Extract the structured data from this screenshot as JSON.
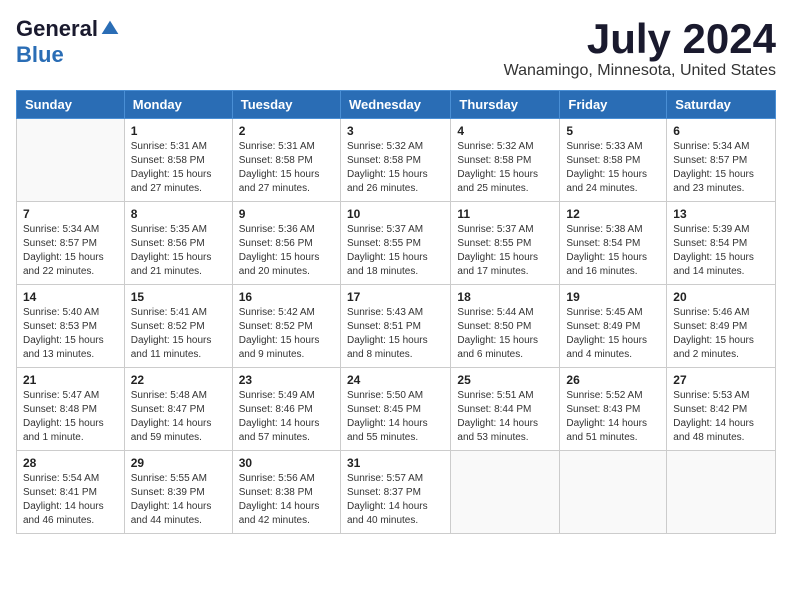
{
  "logo": {
    "general": "General",
    "blue": "Blue"
  },
  "title": "July 2024",
  "location": "Wanamingo, Minnesota, United States",
  "days_of_week": [
    "Sunday",
    "Monday",
    "Tuesday",
    "Wednesday",
    "Thursday",
    "Friday",
    "Saturday"
  ],
  "weeks": [
    [
      {
        "day": "",
        "sunrise": "",
        "sunset": "",
        "daylight": ""
      },
      {
        "day": "1",
        "sunrise": "Sunrise: 5:31 AM",
        "sunset": "Sunset: 8:58 PM",
        "daylight": "Daylight: 15 hours and 27 minutes."
      },
      {
        "day": "2",
        "sunrise": "Sunrise: 5:31 AM",
        "sunset": "Sunset: 8:58 PM",
        "daylight": "Daylight: 15 hours and 27 minutes."
      },
      {
        "day": "3",
        "sunrise": "Sunrise: 5:32 AM",
        "sunset": "Sunset: 8:58 PM",
        "daylight": "Daylight: 15 hours and 26 minutes."
      },
      {
        "day": "4",
        "sunrise": "Sunrise: 5:32 AM",
        "sunset": "Sunset: 8:58 PM",
        "daylight": "Daylight: 15 hours and 25 minutes."
      },
      {
        "day": "5",
        "sunrise": "Sunrise: 5:33 AM",
        "sunset": "Sunset: 8:58 PM",
        "daylight": "Daylight: 15 hours and 24 minutes."
      },
      {
        "day": "6",
        "sunrise": "Sunrise: 5:34 AM",
        "sunset": "Sunset: 8:57 PM",
        "daylight": "Daylight: 15 hours and 23 minutes."
      }
    ],
    [
      {
        "day": "7",
        "sunrise": "Sunrise: 5:34 AM",
        "sunset": "Sunset: 8:57 PM",
        "daylight": "Daylight: 15 hours and 22 minutes."
      },
      {
        "day": "8",
        "sunrise": "Sunrise: 5:35 AM",
        "sunset": "Sunset: 8:56 PM",
        "daylight": "Daylight: 15 hours and 21 minutes."
      },
      {
        "day": "9",
        "sunrise": "Sunrise: 5:36 AM",
        "sunset": "Sunset: 8:56 PM",
        "daylight": "Daylight: 15 hours and 20 minutes."
      },
      {
        "day": "10",
        "sunrise": "Sunrise: 5:37 AM",
        "sunset": "Sunset: 8:55 PM",
        "daylight": "Daylight: 15 hours and 18 minutes."
      },
      {
        "day": "11",
        "sunrise": "Sunrise: 5:37 AM",
        "sunset": "Sunset: 8:55 PM",
        "daylight": "Daylight: 15 hours and 17 minutes."
      },
      {
        "day": "12",
        "sunrise": "Sunrise: 5:38 AM",
        "sunset": "Sunset: 8:54 PM",
        "daylight": "Daylight: 15 hours and 16 minutes."
      },
      {
        "day": "13",
        "sunrise": "Sunrise: 5:39 AM",
        "sunset": "Sunset: 8:54 PM",
        "daylight": "Daylight: 15 hours and 14 minutes."
      }
    ],
    [
      {
        "day": "14",
        "sunrise": "Sunrise: 5:40 AM",
        "sunset": "Sunset: 8:53 PM",
        "daylight": "Daylight: 15 hours and 13 minutes."
      },
      {
        "day": "15",
        "sunrise": "Sunrise: 5:41 AM",
        "sunset": "Sunset: 8:52 PM",
        "daylight": "Daylight: 15 hours and 11 minutes."
      },
      {
        "day": "16",
        "sunrise": "Sunrise: 5:42 AM",
        "sunset": "Sunset: 8:52 PM",
        "daylight": "Daylight: 15 hours and 9 minutes."
      },
      {
        "day": "17",
        "sunrise": "Sunrise: 5:43 AM",
        "sunset": "Sunset: 8:51 PM",
        "daylight": "Daylight: 15 hours and 8 minutes."
      },
      {
        "day": "18",
        "sunrise": "Sunrise: 5:44 AM",
        "sunset": "Sunset: 8:50 PM",
        "daylight": "Daylight: 15 hours and 6 minutes."
      },
      {
        "day": "19",
        "sunrise": "Sunrise: 5:45 AM",
        "sunset": "Sunset: 8:49 PM",
        "daylight": "Daylight: 15 hours and 4 minutes."
      },
      {
        "day": "20",
        "sunrise": "Sunrise: 5:46 AM",
        "sunset": "Sunset: 8:49 PM",
        "daylight": "Daylight: 15 hours and 2 minutes."
      }
    ],
    [
      {
        "day": "21",
        "sunrise": "Sunrise: 5:47 AM",
        "sunset": "Sunset: 8:48 PM",
        "daylight": "Daylight: 15 hours and 1 minute."
      },
      {
        "day": "22",
        "sunrise": "Sunrise: 5:48 AM",
        "sunset": "Sunset: 8:47 PM",
        "daylight": "Daylight: 14 hours and 59 minutes."
      },
      {
        "day": "23",
        "sunrise": "Sunrise: 5:49 AM",
        "sunset": "Sunset: 8:46 PM",
        "daylight": "Daylight: 14 hours and 57 minutes."
      },
      {
        "day": "24",
        "sunrise": "Sunrise: 5:50 AM",
        "sunset": "Sunset: 8:45 PM",
        "daylight": "Daylight: 14 hours and 55 minutes."
      },
      {
        "day": "25",
        "sunrise": "Sunrise: 5:51 AM",
        "sunset": "Sunset: 8:44 PM",
        "daylight": "Daylight: 14 hours and 53 minutes."
      },
      {
        "day": "26",
        "sunrise": "Sunrise: 5:52 AM",
        "sunset": "Sunset: 8:43 PM",
        "daylight": "Daylight: 14 hours and 51 minutes."
      },
      {
        "day": "27",
        "sunrise": "Sunrise: 5:53 AM",
        "sunset": "Sunset: 8:42 PM",
        "daylight": "Daylight: 14 hours and 48 minutes."
      }
    ],
    [
      {
        "day": "28",
        "sunrise": "Sunrise: 5:54 AM",
        "sunset": "Sunset: 8:41 PM",
        "daylight": "Daylight: 14 hours and 46 minutes."
      },
      {
        "day": "29",
        "sunrise": "Sunrise: 5:55 AM",
        "sunset": "Sunset: 8:39 PM",
        "daylight": "Daylight: 14 hours and 44 minutes."
      },
      {
        "day": "30",
        "sunrise": "Sunrise: 5:56 AM",
        "sunset": "Sunset: 8:38 PM",
        "daylight": "Daylight: 14 hours and 42 minutes."
      },
      {
        "day": "31",
        "sunrise": "Sunrise: 5:57 AM",
        "sunset": "Sunset: 8:37 PM",
        "daylight": "Daylight: 14 hours and 40 minutes."
      },
      {
        "day": "",
        "sunrise": "",
        "sunset": "",
        "daylight": ""
      },
      {
        "day": "",
        "sunrise": "",
        "sunset": "",
        "daylight": ""
      },
      {
        "day": "",
        "sunrise": "",
        "sunset": "",
        "daylight": ""
      }
    ]
  ]
}
